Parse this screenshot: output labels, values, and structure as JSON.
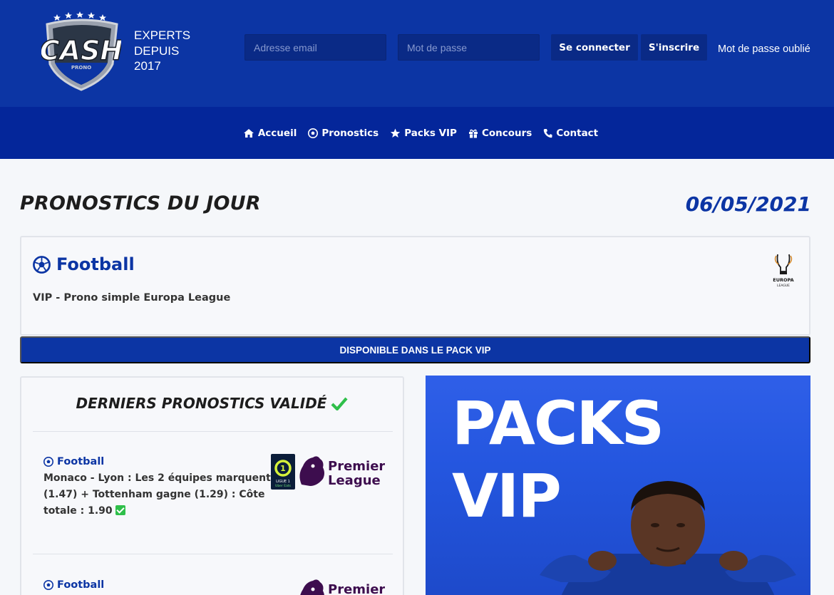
{
  "header": {
    "logo_text": "CASH",
    "logo_subtext": "PRONO",
    "tagline": [
      "EXPERTS",
      "DEPUIS",
      "2017"
    ],
    "email_placeholder": "Adresse email",
    "password_placeholder": "Mot de passe",
    "login_label": "Se connecter",
    "signup_label": "S'inscrire",
    "forgot_label": "Mot de passe oublié"
  },
  "nav": {
    "items": [
      {
        "label": "Accueil",
        "icon": "home-icon"
      },
      {
        "label": "Pronostics",
        "icon": "soccer-ball-icon"
      },
      {
        "label": "Packs VIP",
        "icon": "star-icon"
      },
      {
        "label": "Concours",
        "icon": "gift-icon"
      },
      {
        "label": "Contact",
        "icon": "phone-icon"
      }
    ]
  },
  "main": {
    "title": "PRONOSTICS DU JOUR",
    "date": "06/05/2021",
    "prono": {
      "sport": "Football",
      "description": "VIP - Prono simple Europa League",
      "league_logo": "europa-league-logo",
      "league_logo_text": "EUROPA LEAGUE"
    },
    "vip_bar_label": "DISPONIBLE DANS LE PACK VIP"
  },
  "validated": {
    "title": "DERNIERS PRONOSTICS VALIDÉ",
    "entries": [
      {
        "sport": "Football",
        "text": "Monaco - Lyon : Les 2 équipes marquent (1.47) + Tottenham gagne (1.29) : Côte totale : 1.90",
        "logos": [
          "ligue1-logo",
          "premier-league-logo"
        ]
      },
      {
        "sport": "Football",
        "text": "",
        "logos": [
          "premier-league-logo"
        ]
      }
    ],
    "pl_logo_line1": "Premier",
    "pl_logo_line2": "League",
    "ligue1_line1": "LIGUE 1",
    "ligue1_line2": "Uber Eats"
  },
  "banner": {
    "line1": "PACKS",
    "line2": "VIP"
  },
  "colors": {
    "primary": "#0c35a4",
    "nav": "#04269a",
    "success": "#2fbf4a"
  }
}
